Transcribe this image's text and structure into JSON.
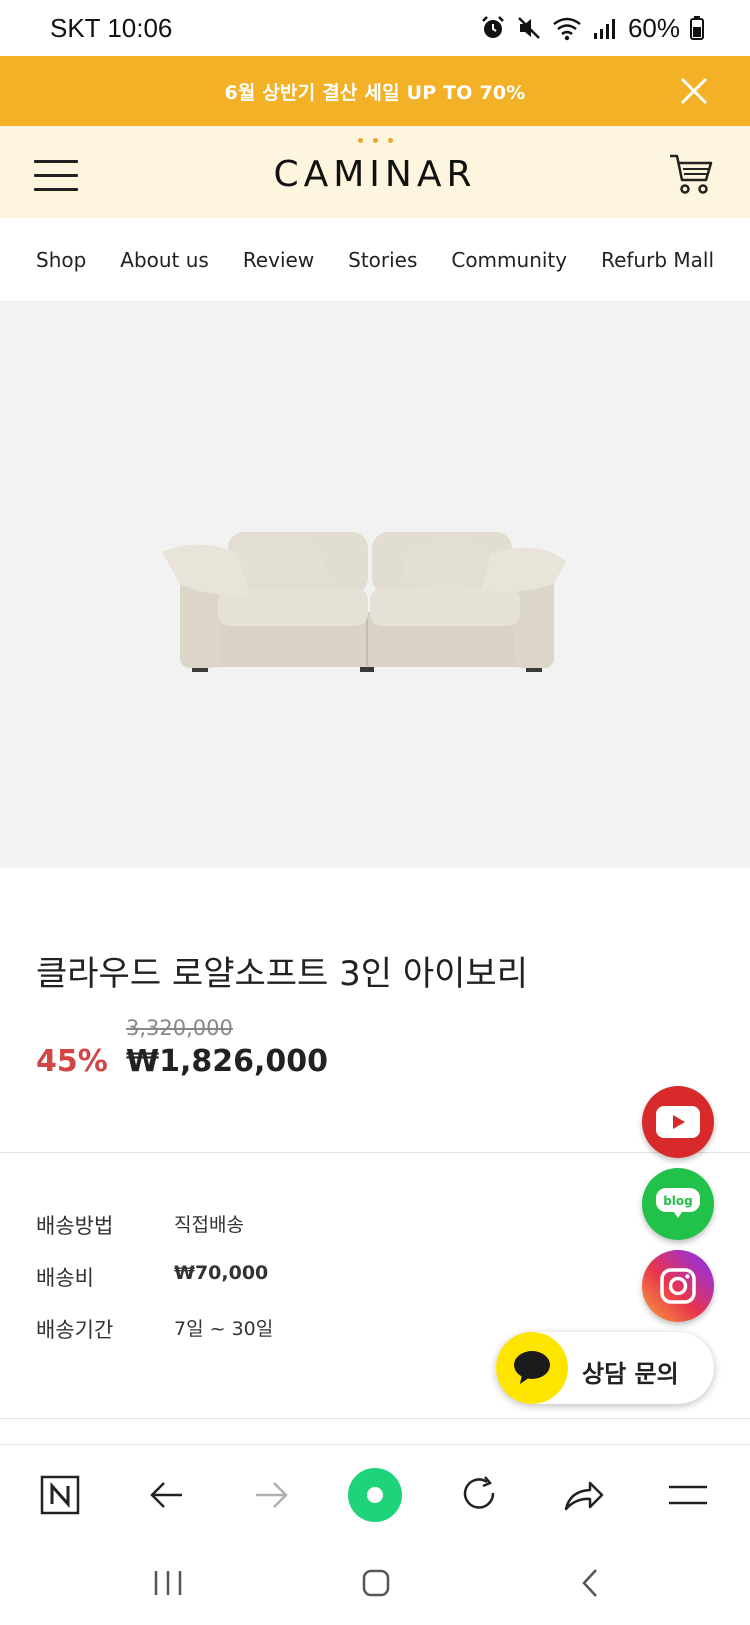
{
  "status_bar": {
    "carrier_time": "SKT 10:06",
    "battery": "60%"
  },
  "promo": {
    "text": "6월 상반기 결산 세일 UP TO 70%"
  },
  "header": {
    "logo": "CAMINAR"
  },
  "nav": {
    "items": [
      "Shop",
      "About us",
      "Review",
      "Stories",
      "Community",
      "Refurb Mall"
    ]
  },
  "product": {
    "title": "클라우드 로얄소프트 3인 아이보리",
    "original_price": "3,320,000",
    "discount": "45%",
    "sale_price": "₩1,826,000"
  },
  "shipping": {
    "rows": [
      {
        "label": "배송방법",
        "value": "직접배송"
      },
      {
        "label": "배송비",
        "value": "₩70,000"
      },
      {
        "label": "배송기간",
        "value": "7일 ~ 30일"
      }
    ]
  },
  "floating": {
    "blog_label": "blog",
    "chat_label": "상담 문의"
  },
  "colors": {
    "promo_bg": "#f3b128",
    "header_bg": "#fdf5dd",
    "discount": "#d04545",
    "accent_green": "#1ed47a"
  },
  "icons": {
    "close": "close-icon",
    "menu": "hamburger-icon",
    "cart": "cart-icon",
    "youtube": "youtube-icon",
    "blog": "blog-icon",
    "instagram": "instagram-icon",
    "chat": "kakao-chat-icon"
  }
}
